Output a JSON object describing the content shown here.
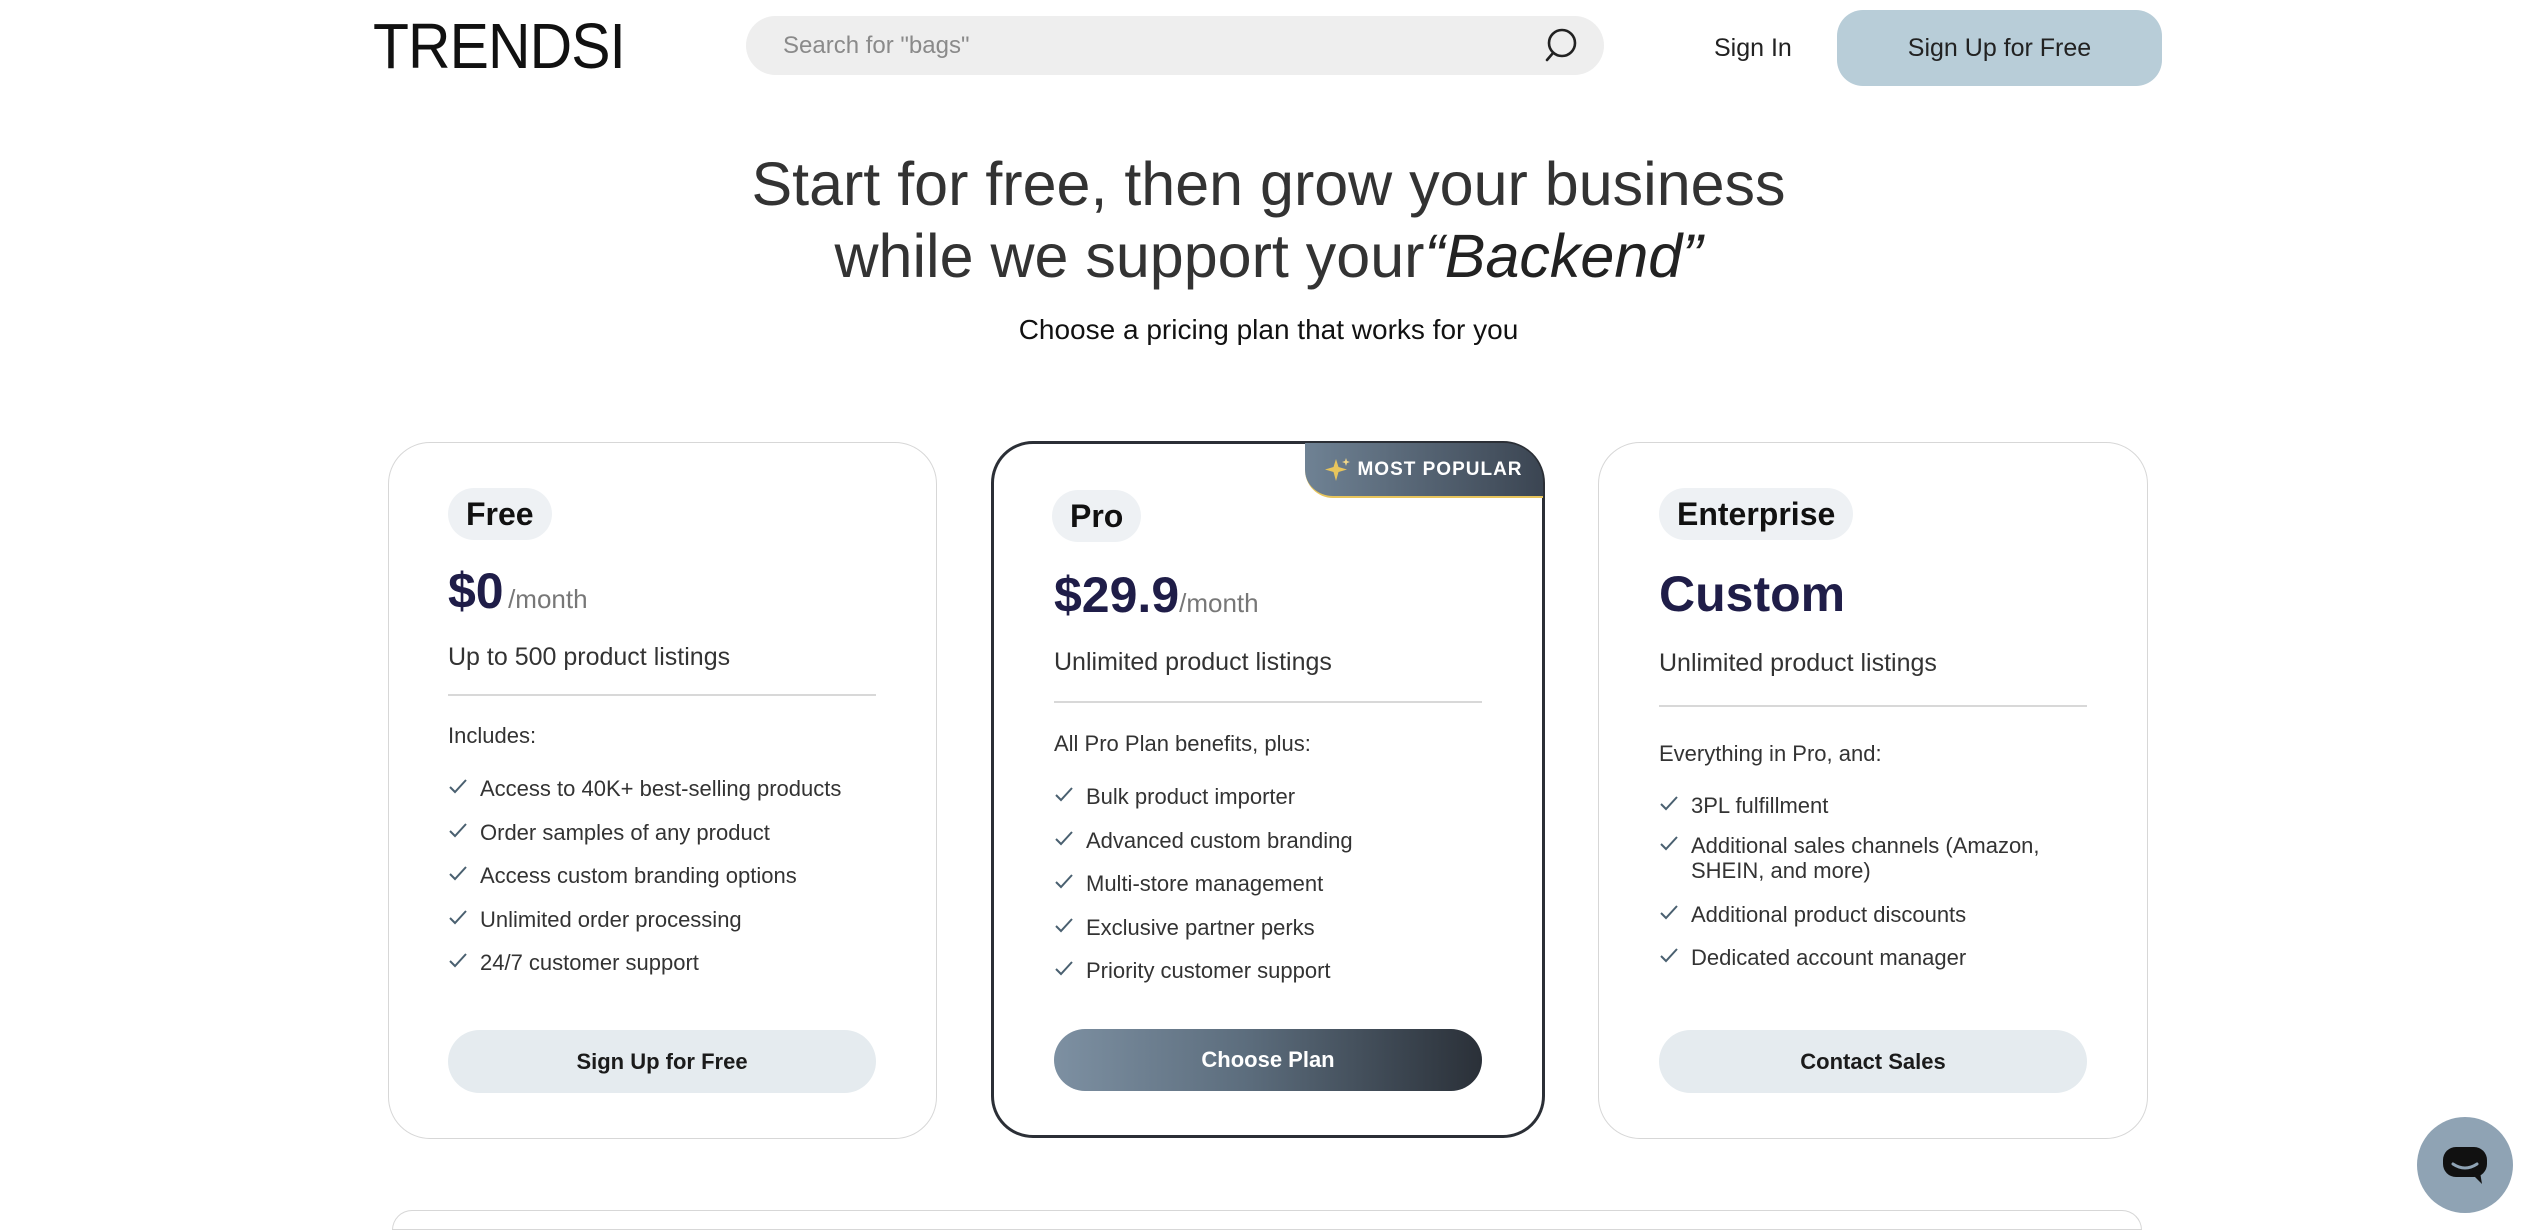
{
  "header": {
    "logo": "TRENDSI",
    "search_placeholder": "Search for \"bags\"",
    "sign_in": "Sign In",
    "sign_up": "Sign Up for Free"
  },
  "hero": {
    "line1": "Start for free, then grow your business",
    "line2_plain": "while we support your",
    "line2_italic": "“Backend”",
    "subtitle": "Choose a pricing plan that works for you"
  },
  "plans": [
    {
      "name": "Free",
      "price": "$0",
      "period": "/month",
      "tagline": "Up to 500 product listings",
      "includes": "Includes:",
      "features": [
        "Access to 40K+ best-selling products",
        "Order samples of any product",
        "Access custom branding options",
        "Unlimited order processing",
        "24/7 customer support"
      ],
      "cta": "Sign Up for Free"
    },
    {
      "name": "Pro",
      "price": "$29.9",
      "period": "/month",
      "badge": "MOST POPULAR",
      "tagline": "Unlimited product listings",
      "includes": "All Pro Plan benefits, plus:",
      "features": [
        "Bulk product importer",
        "Advanced custom branding",
        "Multi-store management",
        "Exclusive partner perks",
        "Priority customer support"
      ],
      "cta": "Choose Plan"
    },
    {
      "name": "Enterprise",
      "price": "Custom",
      "tagline": "Unlimited product listings",
      "includes": "Everything in Pro, and:",
      "features": [
        "3PL fulfillment",
        "Additional sales channels (Amazon, SHEIN, and more)",
        "Additional product discounts",
        "Dedicated account manager"
      ],
      "cta": "Contact Sales"
    }
  ],
  "colors": {
    "accent_button": "#b8cdd8",
    "price_text": "#1f1d48",
    "pro_border": "#2b2f36",
    "light_button": "#e5ebef",
    "chat_button": "#8fa3b4"
  },
  "icons": [
    "search-icon",
    "check-icon",
    "sparkle-icon",
    "chat-icon"
  ]
}
